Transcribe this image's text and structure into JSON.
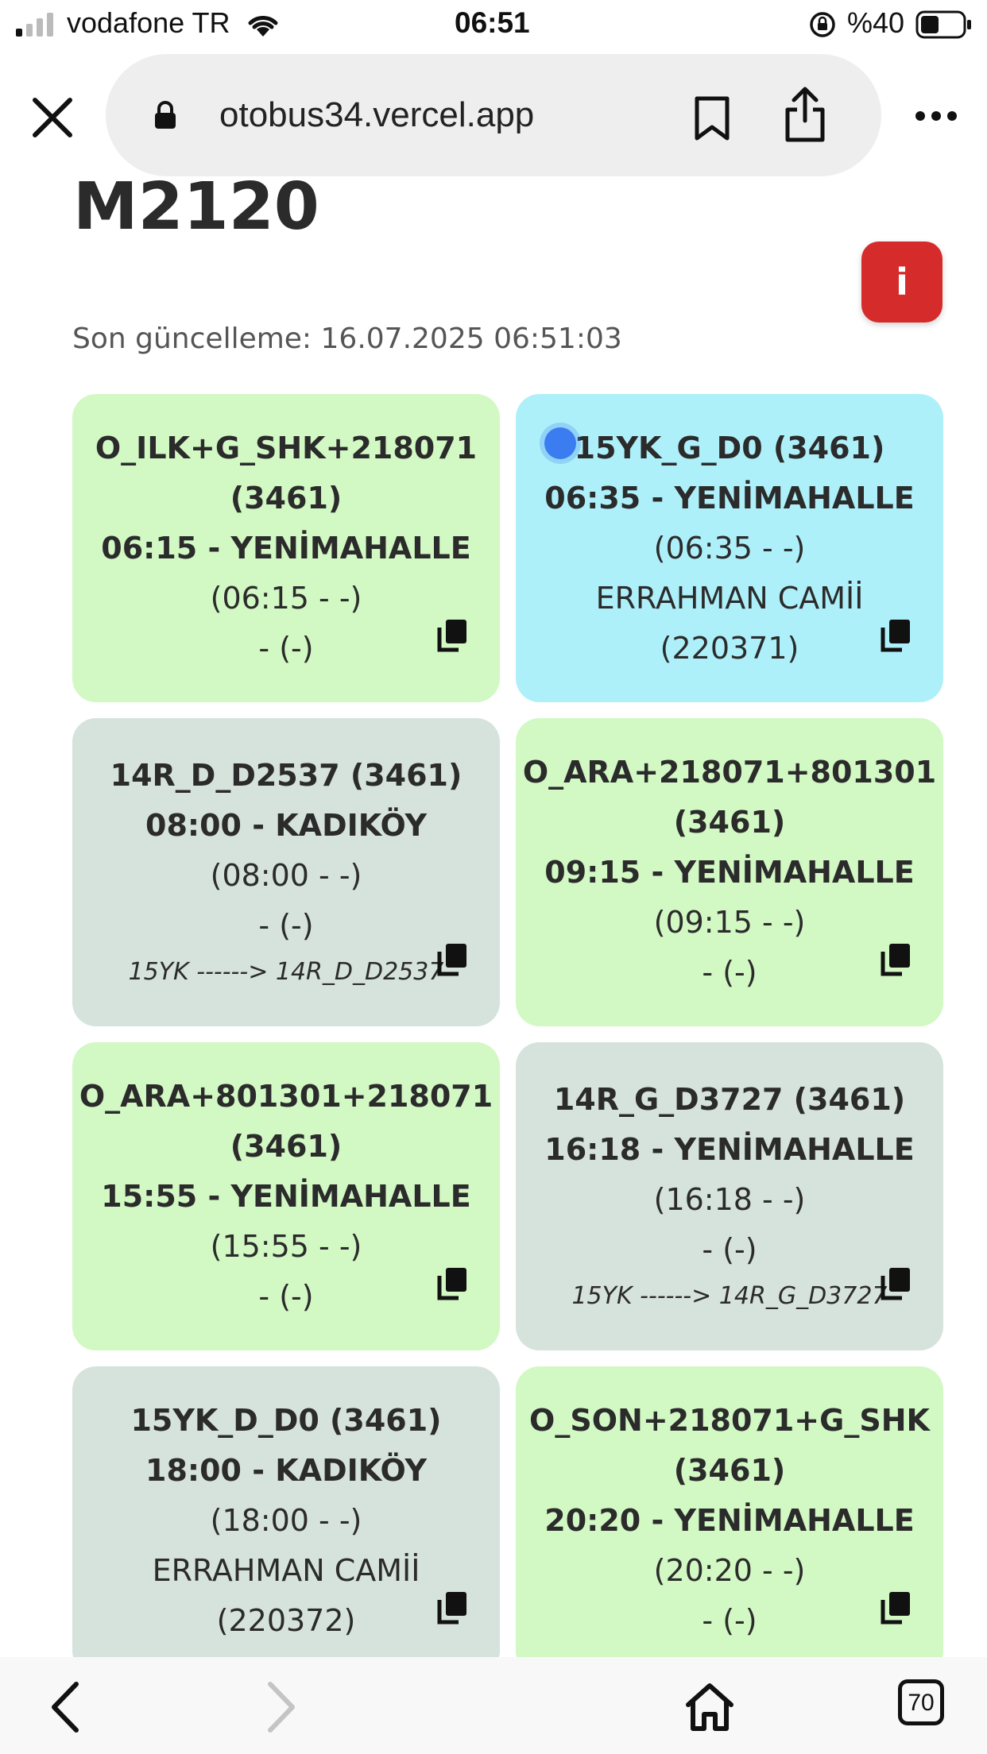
{
  "status_bar": {
    "carrier": "vodafone TR",
    "time": "06:51",
    "battery": "%40"
  },
  "browser": {
    "url": "otobus34.vercel.app",
    "tabs_count": "70"
  },
  "page": {
    "title": "M2120",
    "info_label": "i",
    "last_update_label": "Son güncelleme:",
    "last_update_value": "16.07.2025 06:51:03"
  },
  "cards": [
    {
      "color": "green",
      "live": false,
      "lines": [
        {
          "text": "O_ILK+G_SHK+218071",
          "bold": true
        },
        {
          "text": "(3461)",
          "bold": true
        },
        {
          "text": "06:15 - YENİMAHALLE",
          "bold": true
        },
        {
          "text": "(06:15 - -)",
          "bold": false
        },
        {
          "text": "- (-)",
          "bold": false
        }
      ],
      "note": ""
    },
    {
      "color": "cyan",
      "live": true,
      "lines": [
        {
          "text": "15YK_G_D0 (3461)",
          "bold": true
        },
        {
          "text": "06:35 - YENİMAHALLE",
          "bold": true
        },
        {
          "text": "(06:35 - -)",
          "bold": false
        },
        {
          "text": "ERRAHMAN CAMİİ",
          "bold": false
        },
        {
          "text": "(220371)",
          "bold": false
        }
      ],
      "note": ""
    },
    {
      "color": "grey",
      "live": false,
      "lines": [
        {
          "text": "14R_D_D2537 (3461)",
          "bold": true
        },
        {
          "text": "08:00 - KADIKÖY",
          "bold": true
        },
        {
          "text": "(08:00 - -)",
          "bold": false
        },
        {
          "text": "- (-)",
          "bold": false
        }
      ],
      "note": "15YK ------> 14R_D_D2537"
    },
    {
      "color": "green",
      "live": false,
      "lines": [
        {
          "text": "O_ARA+218071+801301",
          "bold": true
        },
        {
          "text": "(3461)",
          "bold": true
        },
        {
          "text": "09:15 - YENİMAHALLE",
          "bold": true
        },
        {
          "text": "(09:15 - -)",
          "bold": false
        },
        {
          "text": "- (-)",
          "bold": false
        }
      ],
      "note": ""
    },
    {
      "color": "green",
      "live": false,
      "lines": [
        {
          "text": "O_ARA+801301+218071",
          "bold": true
        },
        {
          "text": "(3461)",
          "bold": true
        },
        {
          "text": "15:55 - YENİMAHALLE",
          "bold": true
        },
        {
          "text": "(15:55 - -)",
          "bold": false
        },
        {
          "text": "- (-)",
          "bold": false
        }
      ],
      "note": ""
    },
    {
      "color": "grey",
      "live": false,
      "lines": [
        {
          "text": "14R_G_D3727 (3461)",
          "bold": true
        },
        {
          "text": "16:18 - YENİMAHALLE",
          "bold": true
        },
        {
          "text": "(16:18 - -)",
          "bold": false
        },
        {
          "text": "- (-)",
          "bold": false
        }
      ],
      "note": "15YK ------> 14R_G_D3727"
    },
    {
      "color": "grey",
      "live": false,
      "lines": [
        {
          "text": "15YK_D_D0 (3461)",
          "bold": true
        },
        {
          "text": "18:00 - KADIKÖY",
          "bold": true
        },
        {
          "text": "(18:00 - -)",
          "bold": false
        },
        {
          "text": "ERRAHMAN CAMİİ",
          "bold": false
        },
        {
          "text": "(220372)",
          "bold": false
        }
      ],
      "note": ""
    },
    {
      "color": "green",
      "live": false,
      "lines": [
        {
          "text": "O_SON+218071+G_SHK",
          "bold": true
        },
        {
          "text": "(3461)",
          "bold": true
        },
        {
          "text": "20:20 - YENİMAHALLE",
          "bold": true
        },
        {
          "text": "(20:20 - -)",
          "bold": false
        },
        {
          "text": "- (-)",
          "bold": false
        }
      ],
      "note": ""
    }
  ],
  "colors": {
    "green": "#d2f8c4",
    "cyan": "#aef0fa",
    "grey": "#d6e3dc",
    "info_red": "#d62b2b"
  },
  "icons": [
    "signal-icon",
    "wifi-icon",
    "orientation-lock-icon",
    "battery-icon",
    "close-icon",
    "lock-icon",
    "bookmark-icon",
    "share-icon",
    "more-icon",
    "copy-icon",
    "back-icon",
    "forward-icon",
    "home-icon",
    "tabs-icon"
  ]
}
